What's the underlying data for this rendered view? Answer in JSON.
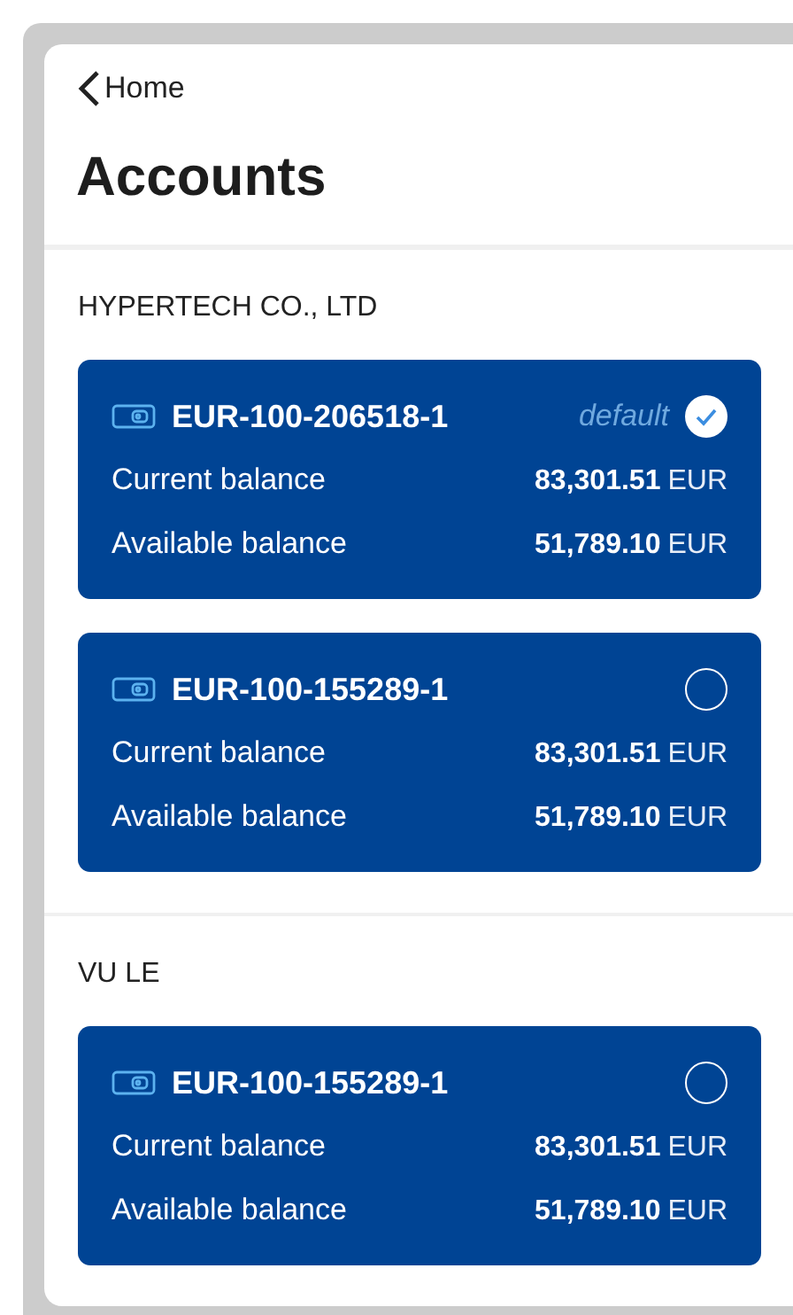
{
  "nav": {
    "back_label": "Home"
  },
  "title": "Accounts",
  "sections": [
    {
      "holder": "HYPERTECH CO., LTD",
      "accounts": [
        {
          "number": "EUR-100-206518-1",
          "badge": "default",
          "selected": true,
          "rows": [
            {
              "label": "Current balance",
              "amount": "83,301.51",
              "currency": "EUR"
            },
            {
              "label": "Available balance",
              "amount": "51,789.10",
              "currency": "EUR"
            }
          ]
        },
        {
          "number": "EUR-100-155289-1",
          "selected": false,
          "rows": [
            {
              "label": "Current balance",
              "amount": "83,301.51",
              "currency": "EUR"
            },
            {
              "label": "Available balance",
              "amount": "51,789.10",
              "currency": "EUR"
            }
          ]
        }
      ]
    },
    {
      "holder": "VU LE",
      "accounts": [
        {
          "number": "EUR-100-155289-1",
          "selected": false,
          "rows": [
            {
              "label": "Current balance",
              "amount": "83,301.51",
              "currency": "EUR"
            },
            {
              "label": "Available balance",
              "amount": "51,789.10",
              "currency": "EUR"
            }
          ]
        }
      ]
    }
  ]
}
